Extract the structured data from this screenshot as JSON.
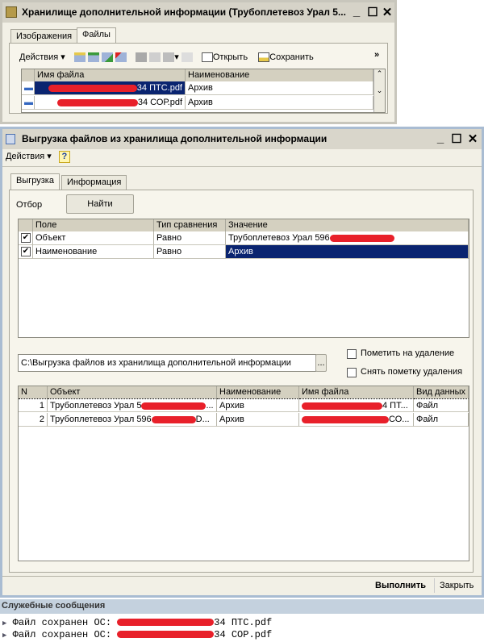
{
  "window1": {
    "title": "Хранилище дополнительной информации (Трубоплетевоз Урал 5...",
    "tabs": [
      "Изображения",
      "Файлы"
    ],
    "toolbar": {
      "actions": "Действия",
      "open": "Открыть",
      "save": "Сохранить",
      "more": "»"
    },
    "columns": [
      "Имя файла",
      "Наименование"
    ],
    "rows": [
      {
        "file": "34 ПТС.pdf",
        "name": "Архив"
      },
      {
        "file": "34 СОР.pdf",
        "name": "Архив"
      }
    ]
  },
  "window2": {
    "title": "Выгрузка файлов из хранилища дополнительной информации",
    "menu": {
      "actions": "Действия",
      "help": "?"
    },
    "tabs": [
      "Выгрузка",
      "Информация"
    ],
    "filter_label": "Отбор",
    "find_button": "Найти",
    "filter_columns": [
      "Поле",
      "Тип сравнения",
      "Значение"
    ],
    "filter_rows": [
      {
        "checked": true,
        "field": "Объект",
        "cmp": "Равно",
        "value": "Трубоплетевоз Урал 596"
      },
      {
        "checked": true,
        "field": "Наименование",
        "cmp": "Равно",
        "value": "Архив"
      }
    ],
    "path": "C:\\Выгрузка файлов из хранилища дополнительной информации",
    "path_button": "...",
    "mark_delete": "Пометить на удаление",
    "unmark_delete": "Снять пометку удаления",
    "result_columns": [
      "N",
      "Объект",
      "Наименование",
      "Имя файла",
      "Вид данных"
    ],
    "result_rows": [
      {
        "n": "1",
        "object": "Трубоплетевоз Урал 5",
        "object_tail": "...",
        "name": "Архив",
        "file": "4 ПТ...",
        "type": "Файл"
      },
      {
        "n": "2",
        "object": "Трубоплетевоз Урал 596",
        "object_tail": "D...",
        "name": "Архив",
        "file": "СО...",
        "type": "Файл"
      }
    ],
    "run": "Выполнить",
    "close": "Закрыть"
  },
  "messages": {
    "title": "Служебные сообщения",
    "lines": [
      {
        "prefix": "Файл сохранен ОС:",
        "suffix": "34 ПТС.pdf"
      },
      {
        "prefix": "Файл сохранен ОС:",
        "suffix": "34 СОР.pdf"
      }
    ]
  }
}
